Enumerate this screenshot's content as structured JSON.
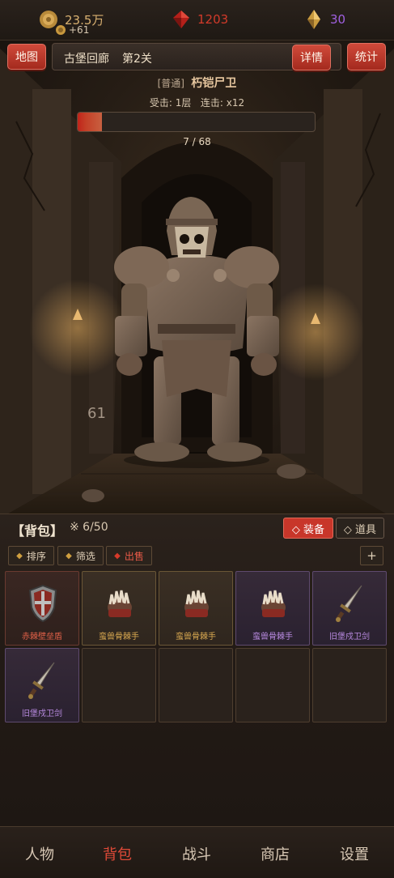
{
  "currency": {
    "gold": "23.5万",
    "gold_income": "+61",
    "gems": "1203",
    "diamonds": "30"
  },
  "stage": {
    "map_button": "地图",
    "location": "古堡回廊",
    "level": "第2关",
    "details_button": "详情",
    "stats_button": "统计"
  },
  "enemy": {
    "tier": "[普通]",
    "name": "朽铠尸卫",
    "hits": "受击: 1层",
    "combo": "连击: x12",
    "hp_text": "7 / 68",
    "hp_current": 7,
    "hp_max": 68,
    "damage_float": "61"
  },
  "bag": {
    "title": "【背包】",
    "count": "※ 6/50",
    "tab_equip": "◇ 装备",
    "tab_items": "◇ 道具",
    "sort": "排序",
    "filter": "筛选",
    "sell": "出售",
    "add": "+",
    "items": [
      {
        "name": "赤棘壁垒盾",
        "icon": "shield-icon",
        "rarity": "red"
      },
      {
        "name": "蛮兽骨棘手",
        "icon": "gauntlet-icon",
        "rarity": "gold"
      },
      {
        "name": "蛮兽骨棘手",
        "icon": "gauntlet-icon",
        "rarity": "gold"
      },
      {
        "name": "蛮兽骨棘手",
        "icon": "gauntlet-icon",
        "rarity": "purple"
      },
      {
        "name": "旧堡戍卫剑",
        "icon": "sword-icon",
        "rarity": "purple"
      },
      {
        "name": "旧堡戍卫剑",
        "icon": "sword-icon",
        "rarity": "purple"
      }
    ]
  },
  "nav": {
    "character": "人物",
    "bag": "背包",
    "battle": "战斗",
    "shop": "商店",
    "settings": "设置"
  },
  "colors": {
    "accent_red": "#c8362a",
    "gold_text": "#d8b070",
    "gem_red": "#d23a2a",
    "diamond_purple": "#a060e0"
  }
}
